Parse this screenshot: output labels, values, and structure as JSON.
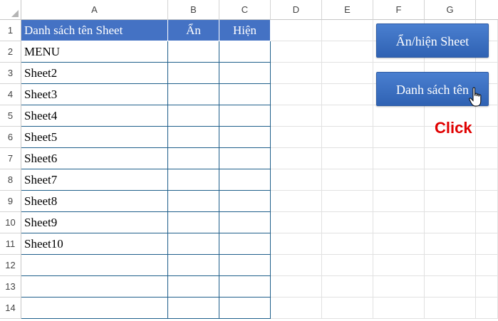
{
  "columns": [
    "A",
    "B",
    "C",
    "D",
    "E",
    "F",
    "G"
  ],
  "rows": [
    "1",
    "2",
    "3",
    "4",
    "5",
    "6",
    "7",
    "8",
    "9",
    "10",
    "11",
    "12",
    "13",
    "14"
  ],
  "table": {
    "header": {
      "a": "Danh sách tên Sheet",
      "b": "Ẩn",
      "c": "Hiện"
    },
    "sheet_names": [
      "MENU",
      "Sheet2",
      "Sheet3",
      "Sheet4",
      "Sheet5",
      "Sheet6",
      "Sheet7",
      "Sheet8",
      "Sheet9",
      "Sheet10",
      "",
      "",
      ""
    ]
  },
  "buttons": {
    "toggle_sheet": "Ẩn/hiện Sheet",
    "list_names": "Danh sách tên"
  },
  "annotation": {
    "click": "Click"
  },
  "colors": {
    "header_fill": "#4472c4",
    "button_fill": "#3a6fc2",
    "annotation": "#e00000"
  }
}
